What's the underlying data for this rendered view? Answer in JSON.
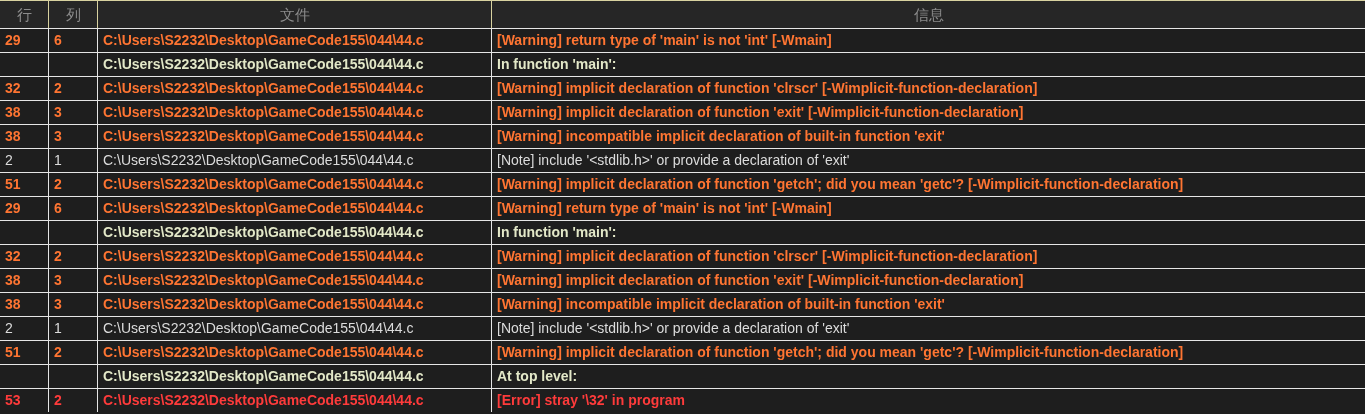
{
  "table": {
    "columns": [
      "行",
      "列",
      "文件",
      "信息"
    ],
    "rows": [
      {
        "kind": "warning",
        "line": "29",
        "col": "6",
        "file": "C:\\Users\\S2232\\Desktop\\GameCode155\\044\\44.c",
        "message": "[Warning] return type of 'main' is not 'int' [-Wmain]"
      },
      {
        "kind": "context",
        "file": "C:\\Users\\S2232\\Desktop\\GameCode155\\044\\44.c",
        "message": "In function 'main':"
      },
      {
        "kind": "warning",
        "line": "32",
        "col": "2",
        "file": "C:\\Users\\S2232\\Desktop\\GameCode155\\044\\44.c",
        "message": "[Warning] implicit declaration of function 'clrscr' [-Wimplicit-function-declaration]"
      },
      {
        "kind": "warning",
        "line": "38",
        "col": "3",
        "file": "C:\\Users\\S2232\\Desktop\\GameCode155\\044\\44.c",
        "message": "[Warning] implicit declaration of function 'exit' [-Wimplicit-function-declaration]"
      },
      {
        "kind": "warning",
        "line": "38",
        "col": "3",
        "file": "C:\\Users\\S2232\\Desktop\\GameCode155\\044\\44.c",
        "message": "[Warning] incompatible implicit declaration of built-in function 'exit'"
      },
      {
        "kind": "note",
        "line": "2",
        "col": "1",
        "file": "C:\\Users\\S2232\\Desktop\\GameCode155\\044\\44.c",
        "message": "[Note] include '<stdlib.h>' or provide a declaration of 'exit'"
      },
      {
        "kind": "warning",
        "line": "51",
        "col": "2",
        "file": "C:\\Users\\S2232\\Desktop\\GameCode155\\044\\44.c",
        "message": "[Warning] implicit declaration of function 'getch'; did you mean 'getc'? [-Wimplicit-function-declaration]"
      },
      {
        "kind": "warning",
        "line": "29",
        "col": "6",
        "file": "C:\\Users\\S2232\\Desktop\\GameCode155\\044\\44.c",
        "message": "[Warning] return type of 'main' is not 'int' [-Wmain]"
      },
      {
        "kind": "context",
        "file": "C:\\Users\\S2232\\Desktop\\GameCode155\\044\\44.c",
        "message": "In function 'main':"
      },
      {
        "kind": "warning",
        "line": "32",
        "col": "2",
        "file": "C:\\Users\\S2232\\Desktop\\GameCode155\\044\\44.c",
        "message": "[Warning] implicit declaration of function 'clrscr' [-Wimplicit-function-declaration]"
      },
      {
        "kind": "warning",
        "line": "38",
        "col": "3",
        "file": "C:\\Users\\S2232\\Desktop\\GameCode155\\044\\44.c",
        "message": "[Warning] implicit declaration of function 'exit' [-Wimplicit-function-declaration]"
      },
      {
        "kind": "warning",
        "line": "38",
        "col": "3",
        "file": "C:\\Users\\S2232\\Desktop\\GameCode155\\044\\44.c",
        "message": "[Warning] incompatible implicit declaration of built-in function 'exit'"
      },
      {
        "kind": "note",
        "line": "2",
        "col": "1",
        "file": "C:\\Users\\S2232\\Desktop\\GameCode155\\044\\44.c",
        "message": "[Note] include '<stdlib.h>' or provide a declaration of 'exit'"
      },
      {
        "kind": "warning",
        "line": "51",
        "col": "2",
        "file": "C:\\Users\\S2232\\Desktop\\GameCode155\\044\\44.c",
        "message": "[Warning] implicit declaration of function 'getch'; did you mean 'getc'? [-Wimplicit-function-declaration]"
      },
      {
        "kind": "context",
        "file": "C:\\Users\\S2232\\Desktop\\GameCode155\\044\\44.c",
        "message": "At top level:"
      },
      {
        "kind": "error",
        "line": "53",
        "col": "2",
        "file": "C:\\Users\\S2232\\Desktop\\GameCode155\\044\\44.c",
        "message": "[Error] stray '\\32' in program"
      }
    ]
  }
}
